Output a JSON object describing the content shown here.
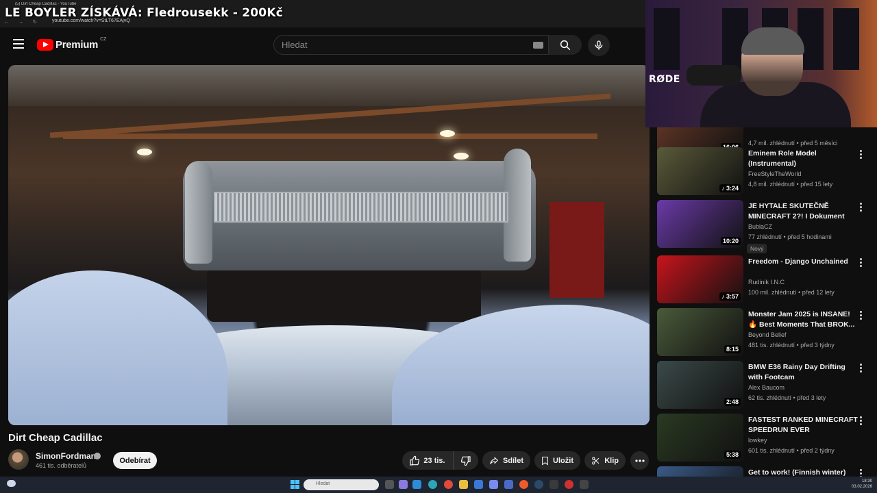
{
  "overlay": {
    "title": "LE BOYLER ZÍSKÁVÁ: Fledrousekk - 200Kč"
  },
  "browser": {
    "tab_title": "(5) Dirt Cheap Cadillac - YouTube",
    "url": "youtube.com/watch?v=StLT67EAjvQ"
  },
  "header": {
    "logo_text": "Premium",
    "country_code": "CZ",
    "search_placeholder": "Hledat"
  },
  "video": {
    "title": "Dirt Cheap Cadillac",
    "channel": "SimonFordman",
    "subscribers": "461 tis. odběratelů",
    "subscribe_label": "Odebírat",
    "likes": "23 tis.",
    "share_label": "Sdílet",
    "save_label": "Uložit",
    "clip_label": "Klip"
  },
  "webcam": {
    "mic_brand": "RØDE"
  },
  "recommendations": [
    {
      "title": "",
      "channel": "",
      "meta": "4,7 mil. zhlédnutí • před 5 měsíci",
      "duration": "16:06",
      "badge": "",
      "thumb": "#6a3a28"
    },
    {
      "title": "Eminem Role Model (Instrumental)",
      "channel": "FreeStyleTheWorld",
      "meta": "4,8 mil. zhlédnutí • před 15 lety",
      "duration": "♪ 3:24",
      "badge": "",
      "thumb": "#5a5a3a"
    },
    {
      "title": "JE HYTALE SKUTEČNĚ MINECRAFT 2?! I Dokument",
      "channel": "BublaCZ",
      "meta": "77 zhlédnutí • před 5 hodinami",
      "duration": "10:20",
      "badge": "Nový",
      "thumb": "#6a3aa8"
    },
    {
      "title": "Freedom - Django Unchained",
      "channel": "Rudinik I.N.C",
      "meta": "100 mil. zhlédnutí • před 12 lety",
      "duration": "♪ 3:57",
      "badge": "",
      "thumb": "#c8141c"
    },
    {
      "title": "Monster Jam 2025 is INSANE! 🔥 Best Moments That BROK...",
      "channel": "Beyond Belief",
      "meta": "481 tis. zhlédnutí • před 3 týdny",
      "duration": "8:15",
      "badge": "",
      "thumb": "#4a5a3a"
    },
    {
      "title": "BMW E36 Rainy Day Drifting with Footcam",
      "channel": "Alex Baucom",
      "meta": "62 tis. zhlédnutí • před 3 lety",
      "duration": "2:48",
      "badge": "",
      "thumb": "#3a4a48"
    },
    {
      "title": "FASTEST RANKED MINECRAFT SPEEDRUN EVER",
      "channel": "lowkey",
      "meta": "601 tis. zhlédnutí • před 2 týdny",
      "duration": "5:38",
      "badge": "",
      "thumb": "#2a3a22"
    },
    {
      "title": "Get to work! (Finnish winter)",
      "channel": "",
      "meta": "",
      "duration": "",
      "badge": "",
      "thumb": "#3a5a88"
    }
  ],
  "taskbar": {
    "search_placeholder": "Hledat",
    "time": "18:30",
    "date": "03.02.2026"
  }
}
